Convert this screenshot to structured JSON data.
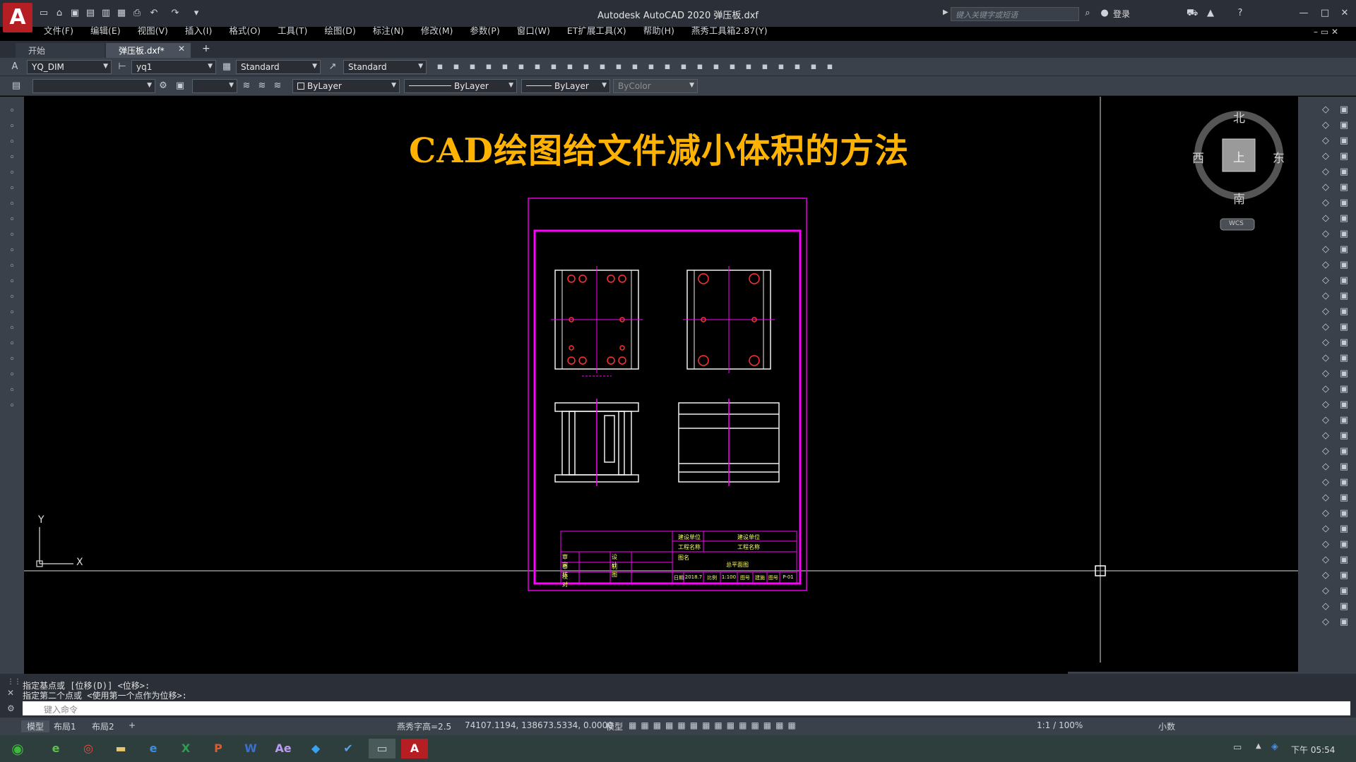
{
  "app": {
    "icon_letter": "A",
    "title": "Autodesk AutoCAD 2020    弹压板.dxf",
    "search_placeholder": "键入关键字或短语",
    "login": "登录"
  },
  "menu": [
    "文件(F)",
    "编辑(E)",
    "视图(V)",
    "插入(I)",
    "格式(O)",
    "工具(T)",
    "绘图(D)",
    "标注(N)",
    "修改(M)",
    "参数(P)",
    "窗口(W)",
    "ET扩展工具(X)",
    "帮助(H)",
    "燕秀工具箱2.87(Y)"
  ],
  "tabs": {
    "start": "开始",
    "file": "弹压板.dxf*",
    "close": "✕",
    "add": "+"
  },
  "toolbar1": {
    "dimstyle": "YQ_DIM",
    "textstyle": "yq1",
    "tablestyle": "Standard",
    "mleaderstyle": "Standard"
  },
  "toolbar2": {
    "layer": "",
    "color": "ByLayer",
    "linetype": "ByLayer",
    "lineweight": "ByLayer",
    "plotstyle": "ByColor"
  },
  "canvas": {
    "title": "CAD绘图给文件减小体积的方法",
    "viewcube": {
      "north": "北",
      "south": "南",
      "west": "西",
      "east": "东",
      "top": "上",
      "wcs": "WCS"
    },
    "ucs": {
      "x": "X",
      "y": "Y"
    },
    "titleblock": {
      "build_unit_label": "建设单位",
      "build_unit_value": "建设单位",
      "project_label": "工程名称",
      "project_value": "工程名称",
      "drawing_label": "图名",
      "drawing_value": "总平面图",
      "rows": [
        [
          "审 定",
          "",
          "设 计",
          ""
        ],
        [
          "审 核",
          "",
          "制 图",
          ""
        ],
        [
          "校 对",
          "",
          "",
          ""
        ]
      ],
      "bottom": [
        "日期",
        "2018.7",
        "比例",
        "1:100",
        "图号",
        "建施",
        "图号",
        "P-01"
      ]
    }
  },
  "command": {
    "line1": "指定基点或 [位移(D)] <位移>:",
    "line2": "指定第二个点或 <使用第一个点作为位移>:",
    "input_placeholder": "键入命令"
  },
  "status": {
    "model_tab": "模型",
    "layout1": "布局1",
    "layout2": "布局2",
    "add": "+",
    "text_height": "燕秀字高=2.5",
    "coords": "74107.1194, 138673.5334, 0.0000",
    "model": "模型",
    "scale": "1:1 / 100%",
    "units": "小数"
  },
  "taskbar": {
    "clock": "下午 05:54"
  },
  "colors": {
    "accent": "#ffb300",
    "magenta": "#ff00ff",
    "red": "#ff3030",
    "app_red": "#b51f24"
  }
}
